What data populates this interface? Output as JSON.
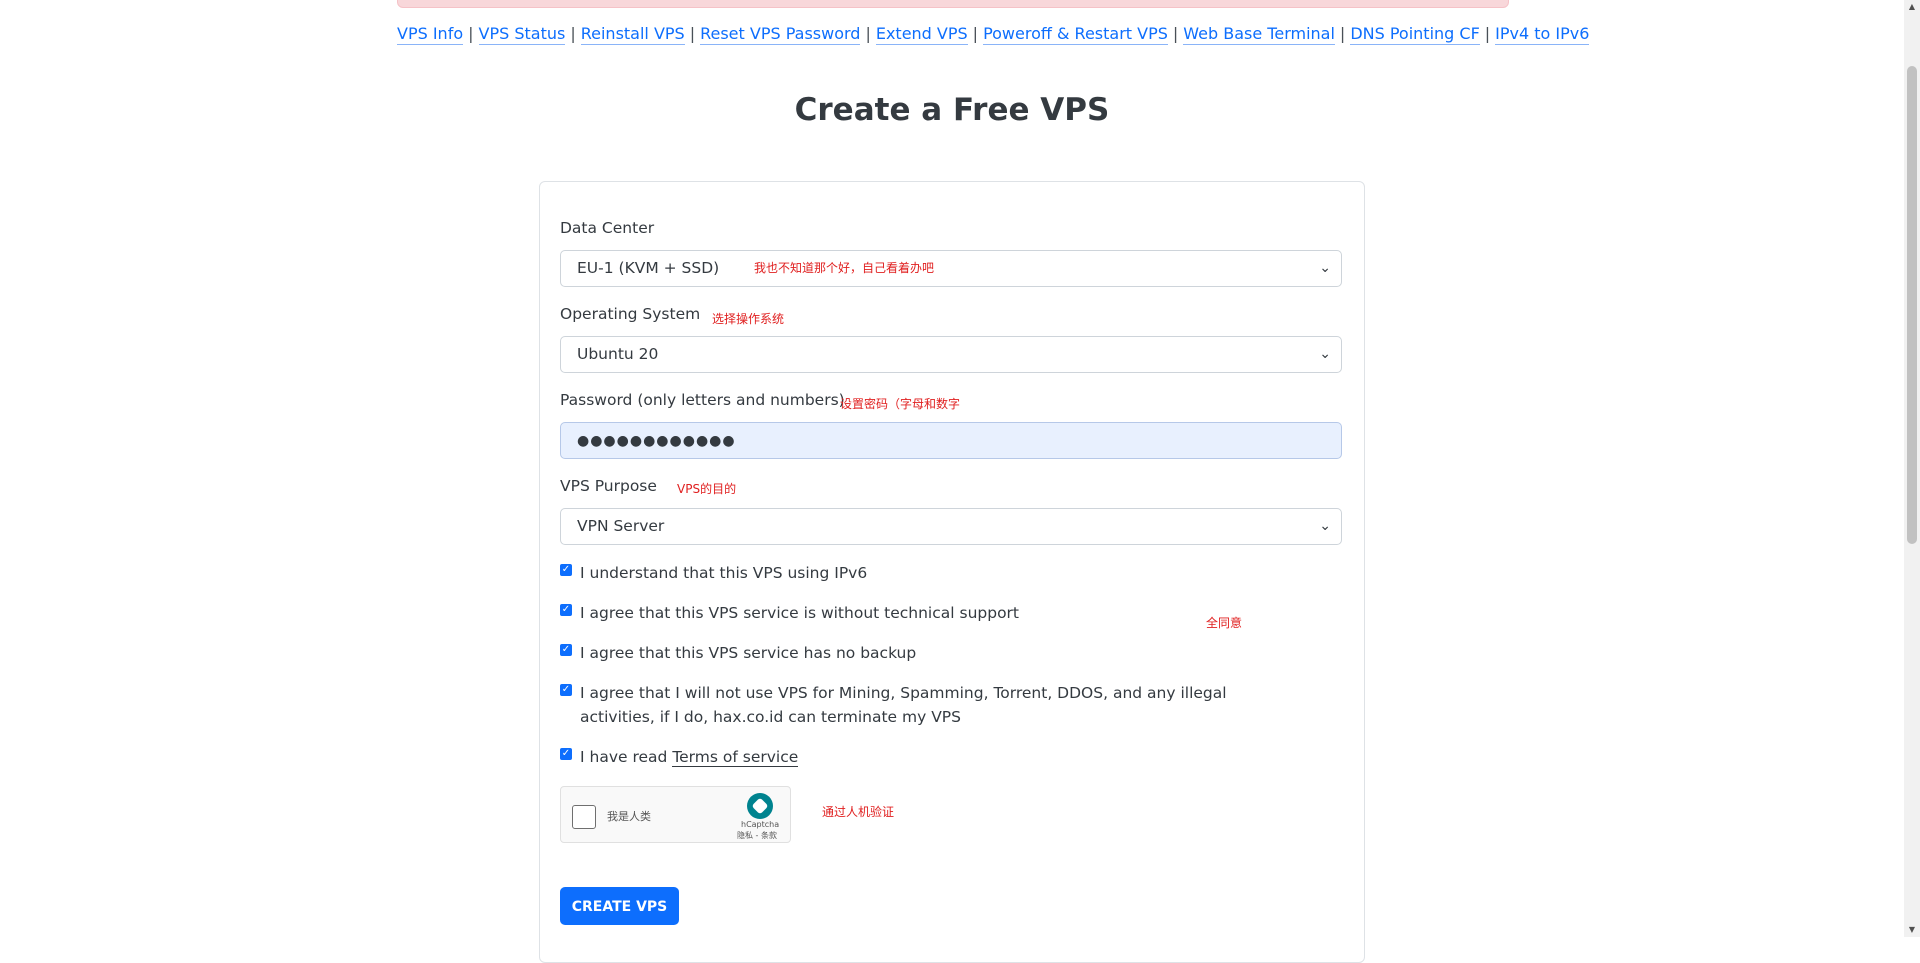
{
  "nav": {
    "links": [
      "VPS Info",
      "VPS Status",
      "Reinstall VPS",
      "Reset VPS Password",
      "Extend VPS",
      "Poweroff & Restart VPS",
      "Web Base Terminal",
      "DNS Pointing CF",
      "IPv4 to IPv6"
    ],
    "separator": "|"
  },
  "page_title": "Create a Free VPS",
  "form": {
    "data_center": {
      "label": "Data Center",
      "value": "EU-1 (KVM + SSD)",
      "note": "我也不知道那个好，自己看着办吧"
    },
    "os": {
      "label": "Operating System",
      "note": "选择操作系统",
      "value": "Ubuntu 20"
    },
    "password": {
      "label": "Password (only letters and numbers)",
      "note": "设置密码（字母和数字",
      "masked_value": "●●●●●●●●●●●●"
    },
    "purpose": {
      "label": "VPS Purpose",
      "note": "VPS的目的",
      "value": "VPN Server"
    },
    "agreements": [
      {
        "text": "I understand that this VPS using IPv6",
        "checked": true
      },
      {
        "text": "I agree that this VPS service is without technical support",
        "checked": true
      },
      {
        "text": "I agree that this VPS service has no backup",
        "checked": true
      },
      {
        "text": "I agree that I will not use VPS for Mining, Spamming, Torrent, DDOS, and any illegal activities, if I do, hax.co.id can terminate my VPS",
        "checked": true
      }
    ],
    "terms": {
      "prefix": "I have read",
      "link": "Terms of service",
      "checked": true
    },
    "agree_note": "全同意",
    "captcha": {
      "label": "我是人类",
      "brand": "hCaptcha",
      "links": "隐私 - 条款",
      "note": "通过人机验证"
    },
    "submit_label": "CREATE VPS"
  },
  "colors": {
    "link": "#0d6efd",
    "button": "#0d6efd",
    "note": "#e02020",
    "alert": "#f8d7da"
  }
}
